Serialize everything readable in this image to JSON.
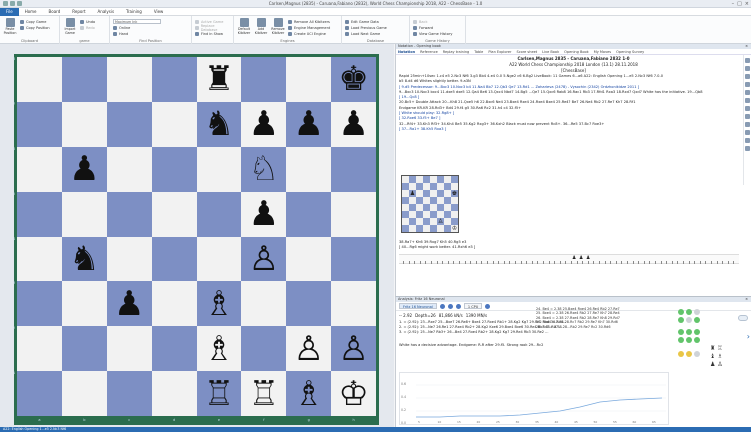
{
  "window": {
    "title": "Carlsen,Magnus (2835) - Caruana,Fabiano (2832), World Chess Championship 2018, A22 - ChessBase - 1.0"
  },
  "ribbon_tabs": [
    "File",
    "Home",
    "Board",
    "Report",
    "Analysis",
    "Training",
    "View"
  ],
  "ribbon": {
    "groups": [
      {
        "name": "Clipboard",
        "buttons": [
          "Paste Position",
          "Copy Game",
          "Copy Position"
        ]
      },
      {
        "name": "game",
        "buttons": [
          "Import Game",
          "Undo",
          "Redo"
        ]
      },
      {
        "name": "Find Position",
        "search": "Maximum Ink",
        "items": [
          "Online",
          "Hand"
        ]
      },
      {
        "name": "",
        "items": [
          "Active Game",
          "Replace Database",
          "Find in Show"
        ]
      },
      {
        "name": "Engines",
        "buttons": [
          "Default Kibitzer",
          "Add Kibitzer",
          "Remove Kibitzer"
        ],
        "list": [
          "Remove All Kibitzers",
          "Engine Management",
          "Create UCI Engine"
        ]
      },
      {
        "name": "Database",
        "list": [
          "Edit Game Data",
          "Load Previous Game",
          "Load Next Game"
        ]
      },
      {
        "name": "Game History",
        "list": [
          "Back",
          "Forward",
          "View Game History"
        ]
      }
    ]
  },
  "board": {
    "files": [
      "a",
      "b",
      "c",
      "d",
      "e",
      "f",
      "g",
      "h"
    ],
    "ranks": [
      "8",
      "7",
      "6",
      "5",
      "4",
      "3",
      "2",
      "1"
    ],
    "rows": [
      [
        "",
        "",
        "",
        "",
        "♜",
        "",
        "",
        "♚"
      ],
      [
        "",
        "",
        "",
        "",
        "♞",
        "♟",
        "♟",
        "♟"
      ],
      [
        "",
        "♟",
        "",
        "",
        "",
        "♘",
        "",
        ""
      ],
      [
        "",
        "",
        "",
        "",
        "",
        "♟",
        "",
        ""
      ],
      [
        "",
        "♞",
        "",
        "",
        "",
        "♙",
        "",
        ""
      ],
      [
        "",
        "",
        "♟",
        "",
        "♗",
        "",
        "",
        ""
      ],
      [
        "",
        "",
        "",
        "",
        "♗",
        "",
        "♙",
        "♙"
      ],
      [
        "",
        "",
        "",
        "",
        "♖",
        "♖",
        "♗",
        "♔"
      ]
    ]
  },
  "notation": {
    "panel_title": "Notation - Opening book",
    "subtabs": [
      "Notation",
      "Reference",
      "Replay training",
      "Table",
      "Plan Explorer",
      "Score sheet",
      "Live Book",
      "Opening Book",
      "My Moves",
      "Opening Survey"
    ],
    "active_subtab": "Notation",
    "head1": "Carlsen,Magnus 2835 - Caruana,Fabiano 2832  1-0",
    "head2": "A22 World Chess Championship 2018 London (13.1)  28.11.2018",
    "head3": "[ChessBase]",
    "lines": [
      "Rapid 25min+10sec  1.c4 e5 2.Nc3 Nf6 3.g3 Bb4 4.e4 0-0 5.Nge2 c6 6.Bg2 LiveBook: 11 Games  6...a6 A22: English Opening 1...e5 2.Nc3 Nf6  7.0-0",
      "b5 8.d4 d6 Whites slightly better. 9.a3N",
      "[ 9.d5 Predecessor: 9...Bxc3 10.Nxc3 b4 11.Na4 Bb7 12.Qb3 Qe7 13.Rd1 ... Zaharieva (2478) - Vysochin (2342) Ordzhonikidze 2011 ]",
      "9...Bxc3 10.Nxc3 bxc4 11.dxe5 dxe5 12.Qa4 Be6 13.Qxc4 Nbd7 14.Bg5 ...Qe7 15.Qxc6 Rab8 16.Rac1 Rb3 17.Rfd1 Rxa3 18.Rxd7 Qxd7 White has the initiative. 19...Qb8",
      "[ 19...Qc8 ]",
      "20.Bc5+ Double Attack 20...Kh8 21.Qxe5 h6 22.Bxc6 Ne4 23.Bxe4 Rxe4 24.Rxe4 Bxe4 25.Re4? Be7 26.Ne4 Rb2 27.Re7 Kh7 28.Rf1",
      "Endgame KR-KR 28.Rd3+ Bd4 29.f4 g5 30.Ra6 Rc2 31.h4 c4 32.f5+",
      "[ White should play: 32.Rg8+ ]",
      "[ 32.Rxe6 33.f5+ Be7 ]",
      "32...Rf4+ 33.Kh3 Rf3+ 34.Kh4 Be5 35.Kg2 Rxg3+ 36.Kxh2 Black must now prevent Rc8+. 36...Re5 37.Bc7 Rxe3+",
      "[ 37...Ra1+ 38.Kh5 Rxa3 ]"
    ],
    "after_lines": [
      "38.Ra7+ Kh6 39.Rxg7 Kh5 40.Rg5 e3",
      "[ 40...Rg6 might work better. 41.Rxh6 e3 ]"
    ],
    "mini_board": [
      [
        "",
        "",
        "",
        "",
        "",
        "",
        "",
        ""
      ],
      [
        "",
        "",
        "",
        "",
        "",
        "",
        "",
        ""
      ],
      [
        "",
        "♟",
        "",
        "",
        "",
        "",
        "",
        "♚"
      ],
      [
        "",
        "",
        "",
        "",
        "",
        "",
        "",
        ""
      ],
      [
        "",
        "",
        "",
        "",
        "",
        "",
        "",
        ""
      ],
      [
        "",
        "",
        "",
        "",
        "",
        "",
        "",
        ""
      ],
      [
        "",
        "",
        "",
        "",
        "",
        "♙",
        "",
        ""
      ],
      [
        "",
        "",
        "",
        "",
        "",
        "",
        "",
        "♔"
      ]
    ]
  },
  "engine": {
    "panel_title": "Analysis: Fritz 16 Neuronal",
    "engine_name": "Fritz 16 Neuronal",
    "cpu": "1 CPU",
    "score_chip": "-- 2.92",
    "depth": "Depth=26",
    "nodes": "81,866 kN/s",
    "speed": "1390 MN/s",
    "lines": [
      "1. = (2.92): 23...Rxe7 25...Bxe7 26.Re8+ Bxe4 27.Rxe4 Rb1+ 28.Kg2 Kg7 29.Re2 Rb4 30.Rc4...",
      "2. = (2.92): 25...Ne7 26.Re1 27.Rxe4 Rb2+ 28.Kg2 Kxe6 29.Bxe4 Bxe6 30.Re4 Rb3 31.Rd7 ...",
      "3. = (2.92): 25...Ne7 Rb3+ 26...Be4 27.Rxe4 Rb2+ 28.Kg2 Kg7 29.Re4 Rb3 30.Re2 ..."
    ],
    "verdict": "White has a decisive advantage. Endgame: R-R after 29.f5. Strong rook 29...Rc2",
    "info": [
      "24. Be4 = 2.38 25.Bxe4 Rxe4 26.Re4 Rb2 27.Re7",
      "25. Bxe4 = 2.38 26.Rxe4 Rb2 27.Re7 Kh7 28.Re4",
      "26. Bxe4 = 2.38 27.Rxe4 Rb2 28.Re7 Kh8 29.Rd7",
      "27. Rxe4 = 2.38 28.Rc7 Rb2 29.Re7 Kh7 30.Rd6",
      "28. Rd7 = 2.38 28...Rb2 29.Re7 Rc2 30.Rd6"
    ],
    "graph_y": [
      "0.6",
      "0.4",
      "0.2",
      "0.0"
    ],
    "graph_x": [
      "5",
      "10",
      "15",
      "20",
      "25",
      "30",
      "35",
      "40",
      "45",
      "50",
      "55",
      "60",
      "65"
    ]
  },
  "status_bar": "A22: English Opening 1...e5 2.Nc3 Nf6"
}
